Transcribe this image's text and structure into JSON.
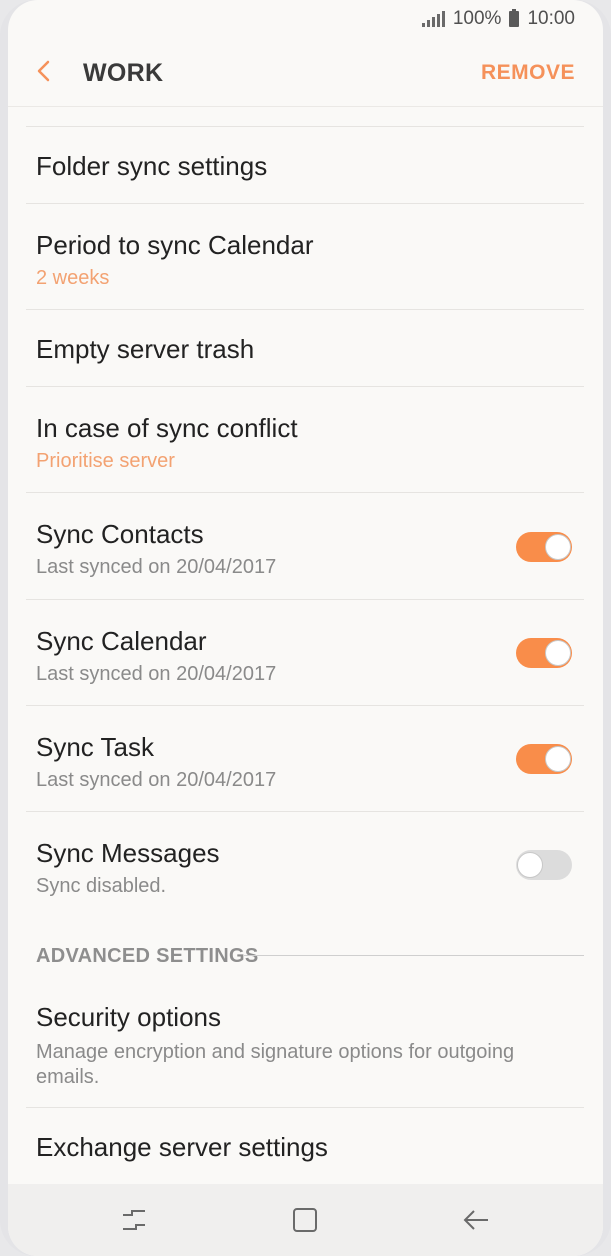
{
  "status": {
    "battery": "100%",
    "time": "10:00"
  },
  "header": {
    "title": "WORK",
    "remove_label": "REMOVE"
  },
  "items": [
    {
      "label": "Folder sync settings"
    },
    {
      "label": "Period to sync Calendar",
      "sub": "2 weeks"
    },
    {
      "label": "Empty server trash"
    },
    {
      "label": "In case of sync conflict",
      "sub": "Prioritise server"
    },
    {
      "label": "Sync Contacts",
      "sub": "Last synced on 20/04/2017",
      "toggle": "on"
    },
    {
      "label": "Sync Calendar",
      "sub": "Last synced on 20/04/2017",
      "toggle": "on"
    },
    {
      "label": "Sync Task",
      "sub": "Last synced on 20/04/2017",
      "toggle": "on"
    },
    {
      "label": "Sync Messages",
      "sub": "Sync disabled.",
      "toggle": "off"
    }
  ],
  "advanced": {
    "header": "ADVANCED SETTINGS",
    "items": [
      {
        "label": "Security options",
        "sub_line1": "Manage encryption and signature options for outgoing",
        "sub_line2": "emails."
      },
      {
        "label": "Exchange server settings"
      }
    ]
  },
  "colors": {
    "accent": "#f98d4a",
    "accent_text": "#f3a272"
  }
}
